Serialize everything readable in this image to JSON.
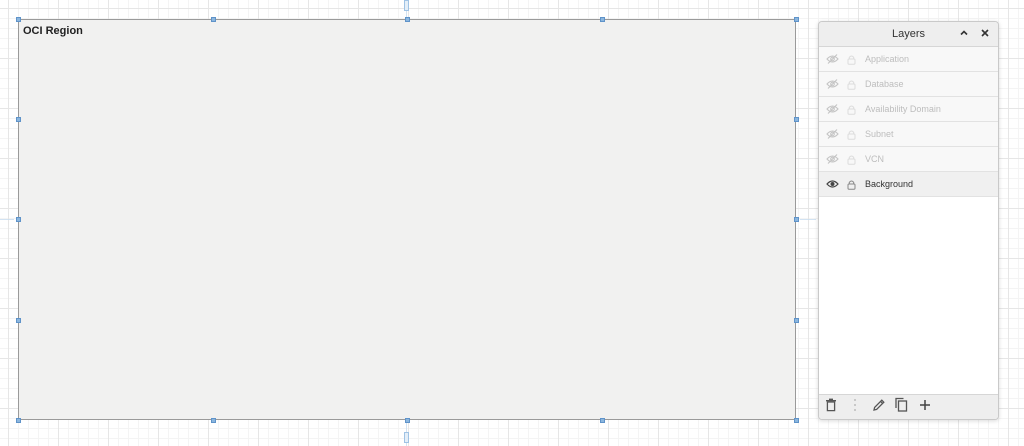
{
  "canvas": {
    "region_label": "OCI Region",
    "selection_color": "#5f93c9",
    "region_fill": "#f1f1f0"
  },
  "layers_panel": {
    "title": "Layers",
    "collapse_icon": "chevron-up-icon",
    "close_icon": "close-icon",
    "items": [
      {
        "label": "Application",
        "visibility_icon": "eye-off-icon",
        "lock_icon": "lock-icon",
        "active": false
      },
      {
        "label": "Database",
        "visibility_icon": "eye-off-icon",
        "lock_icon": "lock-icon",
        "active": false
      },
      {
        "label": "Availability Domain",
        "visibility_icon": "eye-off-icon",
        "lock_icon": "lock-icon",
        "active": false
      },
      {
        "label": "Subnet",
        "visibility_icon": "eye-off-icon",
        "lock_icon": "lock-icon",
        "active": false
      },
      {
        "label": "VCN",
        "visibility_icon": "eye-off-icon",
        "lock_icon": "lock-icon",
        "active": false
      },
      {
        "label": "Background",
        "visibility_icon": "eye-icon",
        "lock_icon": "lock-icon",
        "active": true
      }
    ],
    "footer_icons": [
      "trash-icon",
      "more-vertical-icon",
      "pencil-icon",
      "duplicate-icon",
      "plus-icon"
    ]
  }
}
